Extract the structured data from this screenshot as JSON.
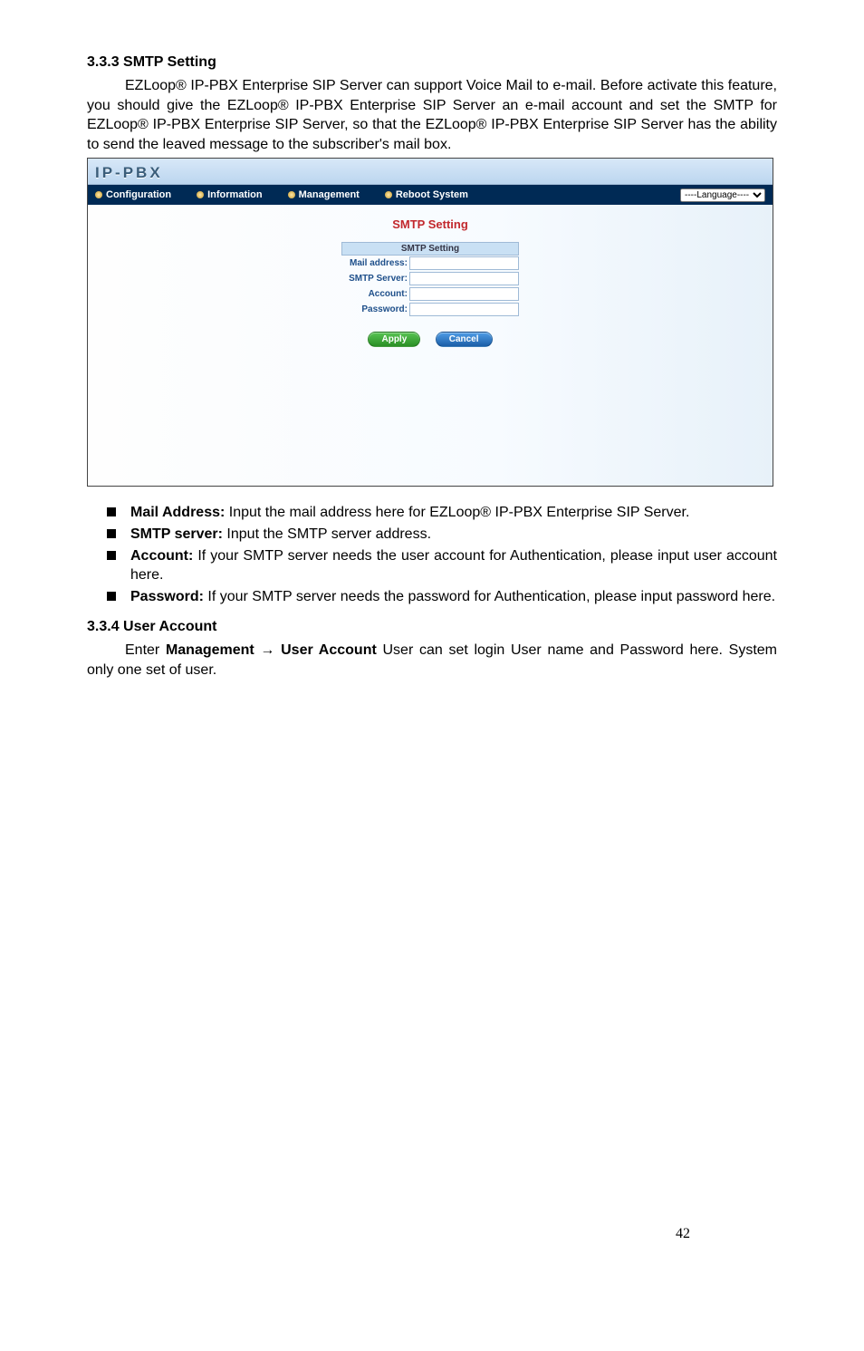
{
  "section333": {
    "heading": "3.3.3 SMTP Setting",
    "paragraph": "EZLoop® IP-PBX Enterprise SIP Server can support Voice Mail to e-mail. Before activate this feature, you should give the EZLoop® IP-PBX Enterprise SIP Server an e-mail account and set the SMTP for EZLoop® IP-PBX Enterprise SIP Server, so that the EZLoop® IP-PBX Enterprise SIP Server has the ability to send the leaved message to the subscriber's mail box."
  },
  "screenshot": {
    "logo": "IP-PBX",
    "nav": {
      "items": [
        "Configuration",
        "Information",
        "Management",
        "Reboot System"
      ],
      "language_placeholder": "----Language----"
    },
    "panel_title": "SMTP Setting",
    "table_header": "SMTP Setting",
    "rows": [
      {
        "label": "Mail address:",
        "value": ""
      },
      {
        "label": "SMTP Server:",
        "value": ""
      },
      {
        "label": "Account:",
        "value": ""
      },
      {
        "label": "Password:",
        "value": ""
      }
    ],
    "buttons": {
      "apply": "Apply",
      "cancel": "Cancel"
    }
  },
  "bullets": [
    {
      "bold": "Mail Address:",
      "rest": " Input the mail address here for EZLoop® IP-PBX Enterprise SIP Server."
    },
    {
      "bold": "SMTP server:",
      "rest": " Input the SMTP server address."
    },
    {
      "bold": "Account:",
      "rest": " If your SMTP server needs the user account for Authentication, please input user account here."
    },
    {
      "bold": "Password:",
      "rest": " If your SMTP server needs the password for Authentication, please input password here."
    }
  ],
  "section334": {
    "heading": "3.3.4 User Account",
    "para_pre": "Enter ",
    "para_bold": "Management → User Account",
    "para_post": " User can set login User name and Password here. System only one set of user."
  },
  "page_number": "42"
}
